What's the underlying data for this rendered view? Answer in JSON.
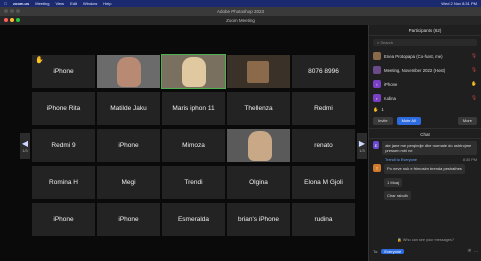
{
  "menubar": {
    "items": [
      "zoom.us",
      "Meeting",
      "View",
      "Edit",
      "Window",
      "Help"
    ],
    "clock": "Wed 2 Nov 8:31 PM"
  },
  "photoshop_title": "Adobe Photoshop 2023",
  "zoom_title": "Zoom Meeting",
  "gallery": {
    "tiles": [
      {
        "name": "iPhone"
      },
      {
        "name": ""
      },
      {
        "name": ""
      },
      {
        "name": ""
      },
      {
        "name": "8076 8996"
      },
      {
        "name": "iPhone Rita"
      },
      {
        "name": "Matilde Jaku"
      },
      {
        "name": "Maris iphon 11"
      },
      {
        "name": "Thellenza"
      },
      {
        "name": "Redmi"
      },
      {
        "name": "Redmi 9"
      },
      {
        "name": "iPhone"
      },
      {
        "name": "Mimoza"
      },
      {
        "name": ""
      },
      {
        "name": "renato"
      },
      {
        "name": "Romina H"
      },
      {
        "name": "Megi"
      },
      {
        "name": "Trendi"
      },
      {
        "name": "Olgina"
      },
      {
        "name": "Elona M Gjoli"
      },
      {
        "name": "iPhone"
      },
      {
        "name": "iPhone"
      },
      {
        "name": "Esmeralda"
      },
      {
        "name": "brian's iPhone"
      },
      {
        "name": "rudina"
      }
    ],
    "page_left": "1/3",
    "page_right": "1/3",
    "arrow_left": "◀",
    "arrow_right": "▶"
  },
  "participants": {
    "header": "Participants (62)",
    "search_placeholder": "Search",
    "list": [
      {
        "name": "Enea Protopapa (Co-host, me)",
        "initial": "",
        "color": "#8a6a4a"
      },
      {
        "name": "Meeting, November 2022 (Host)",
        "initial": "",
        "color": "#6a4a8a"
      },
      {
        "name": "iPhone",
        "initial": "i",
        "color": "#7a3fc4"
      },
      {
        "name": "rudina",
        "initial": "r",
        "color": "#7a3fc4"
      }
    ],
    "raised_count": "1",
    "invite": "Invite",
    "mute_all": "Mute All",
    "more": "More"
  },
  "chat": {
    "header": "Chat",
    "messages": [
      {
        "initial": "E",
        "color": "#6a4ad0",
        "text": "ate jane me perqindje dhe normale do ushtrojme pressen mbi ne"
      },
      {
        "system": "Trendi to Everyone",
        "time": "8:30 PM"
      },
      {
        "initial": "T",
        "color": "#d07a2a",
        "text": "Po neve nuk e frimosim brenda peshathes"
      },
      {
        "initial": "",
        "color": "",
        "text": "1 Muaj"
      },
      {
        "initial": "",
        "color": "",
        "text": "Char rabulh"
      }
    ],
    "who_can_see": "Who can see your messages?",
    "to_label": "To:",
    "to_target": "Everyone"
  }
}
